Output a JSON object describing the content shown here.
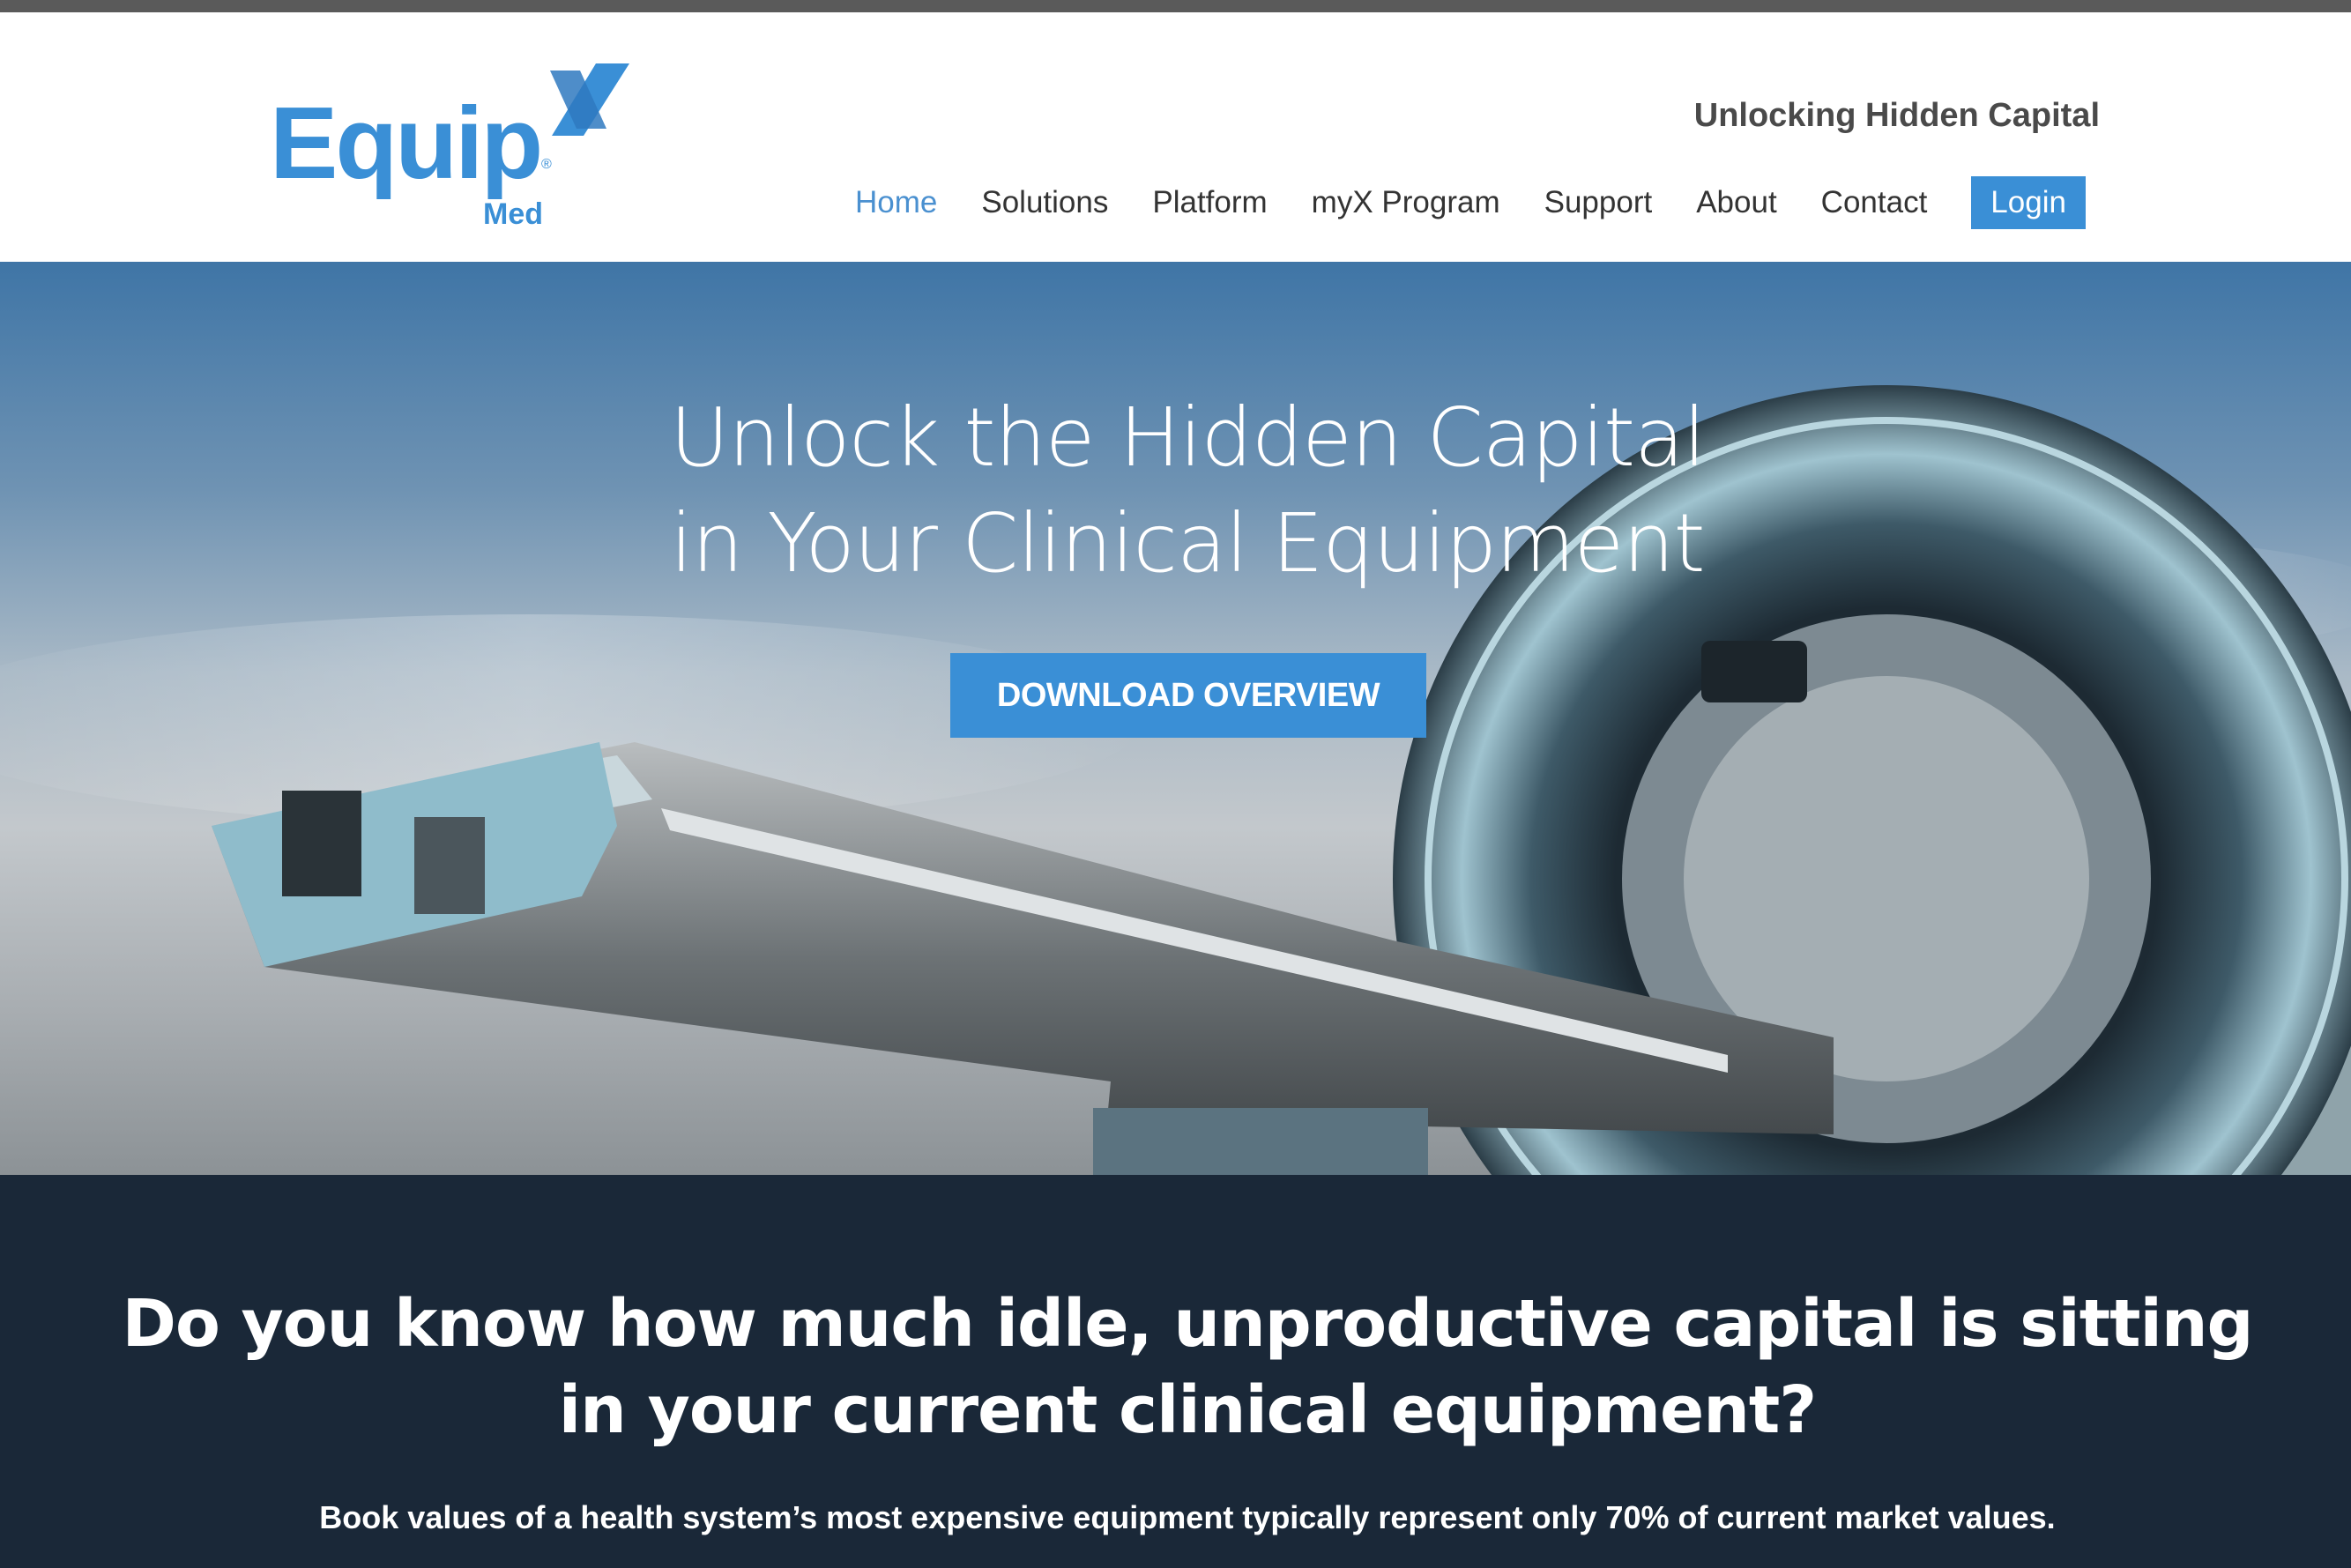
{
  "brand": {
    "logo_word": "Equip",
    "logo_mark": "X",
    "logo_sub": "Med",
    "logo_reg": "®",
    "tagline": "Unlocking Hidden Capital",
    "accent_color": "#3a8fd6"
  },
  "nav": {
    "items": [
      {
        "label": "Home",
        "active": true
      },
      {
        "label": "Solutions",
        "active": false
      },
      {
        "label": "Platform",
        "active": false
      },
      {
        "label": "myX Program",
        "active": false
      },
      {
        "label": "Support",
        "active": false
      },
      {
        "label": "About",
        "active": false
      },
      {
        "label": "Contact",
        "active": false
      }
    ],
    "login_label": "Login"
  },
  "hero": {
    "title_line1": "Unlock the Hidden Capital",
    "title_line2": "in Your Clinical Equipment",
    "cta_label": "DOWNLOAD OVERVIEW",
    "image": "ct-scanner-illustration"
  },
  "info": {
    "question_line1": "Do you know how much idle, unproductive capital is sitting",
    "question_line2": "in your current clinical equipment?",
    "note": "Book values of a health system’s most expensive equipment typically represent only 70% of current market values."
  }
}
